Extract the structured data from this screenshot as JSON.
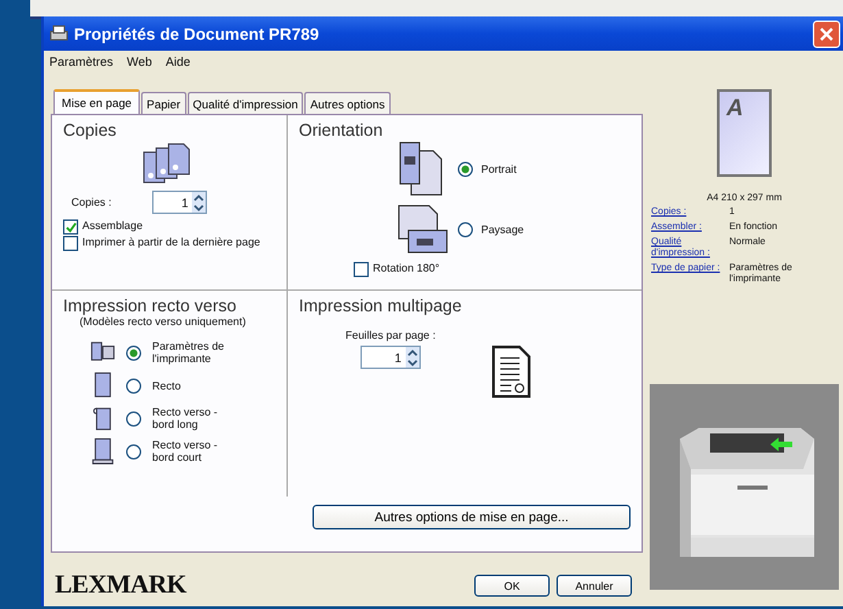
{
  "window": {
    "title": "Propriétés de Document PR789"
  },
  "menu": [
    "Paramètres",
    "Web",
    "Aide"
  ],
  "tabs": [
    {
      "label": "Mise en page",
      "selected": true
    },
    {
      "label": "Papier",
      "selected": false
    },
    {
      "label": "Qualité d'impression",
      "selected": false
    },
    {
      "label": "Autres options",
      "selected": false
    }
  ],
  "copies": {
    "title": "Copies",
    "label": "Copies :",
    "value": "1",
    "options": [
      {
        "label": "Assemblage",
        "checked": true
      },
      {
        "label": "Imprimer à partir de la dernière page",
        "checked": false
      }
    ]
  },
  "orientation": {
    "title": "Orientation",
    "options": [
      {
        "label": "Portrait",
        "selected": true
      },
      {
        "label": "Paysage",
        "selected": false
      }
    ],
    "rotation": {
      "label": "Rotation 180°",
      "checked": false
    }
  },
  "duplex": {
    "title": "Impression recto verso",
    "subtitle": "(Modèles recto verso uniquement)",
    "options": [
      {
        "label": "Paramètres de l'imprimante",
        "selected": true
      },
      {
        "label": "Recto",
        "selected": false
      },
      {
        "label": "Recto verso - bord long",
        "selected": false
      },
      {
        "label": "Recto verso - bord court",
        "selected": false
      }
    ]
  },
  "multipage": {
    "title": "Impression multipage",
    "label": "Feuilles par page :",
    "value": "1"
  },
  "more_button": "Autres options de mise en page...",
  "summary": {
    "preview_letter": "A",
    "paper_size": "A4 210 x 297 mm",
    "rows": [
      {
        "label": "Copies :",
        "value": "1"
      },
      {
        "label": "Assembler :",
        "value": "En fonction"
      },
      {
        "label": "Qualité d'impression :",
        "value": "Normale"
      },
      {
        "label": "Type de papier :",
        "value": "Paramètres de l'imprimante"
      }
    ]
  },
  "logo": "LEXMARK",
  "buttons": [
    "OK",
    "Annuler"
  ]
}
